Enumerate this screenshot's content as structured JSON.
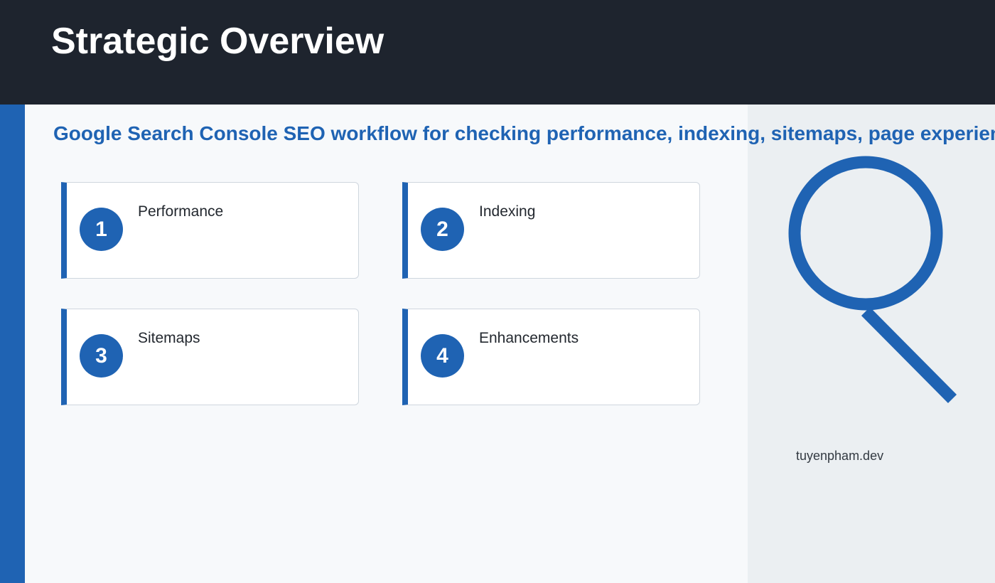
{
  "header": {
    "title": "Strategic Overview"
  },
  "subtitle": "Google Search Console SEO workflow for checking performance, indexing, sitemaps, page experience and enhancements",
  "steps": [
    {
      "number": "1",
      "label": "Performance"
    },
    {
      "number": "2",
      "label": "Indexing"
    },
    {
      "number": "3",
      "label": "Sitemaps"
    },
    {
      "number": "4",
      "label": "Enhancements"
    }
  ],
  "illustration": {
    "icon": "magnifying-glass-icon"
  },
  "footer": {
    "credit": "tuyenpham.dev"
  },
  "colors": {
    "header_bg": "#1e242e",
    "accent": "#1f63b3",
    "panel_bg": "#ebeff2",
    "main_bg": "#f7f9fb"
  }
}
